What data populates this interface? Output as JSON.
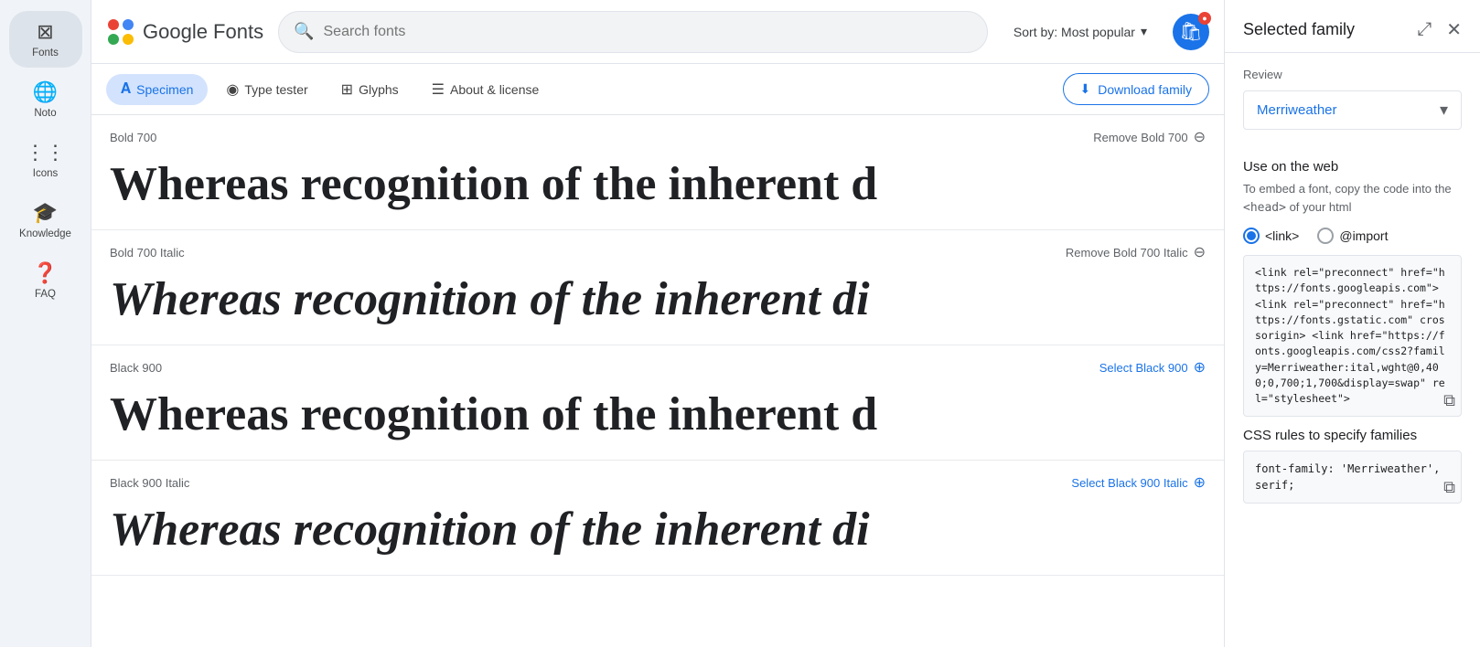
{
  "sidebar": {
    "items": [
      {
        "id": "fonts",
        "label": "Fonts",
        "icon": "🔤"
      },
      {
        "id": "noto",
        "label": "Noto",
        "icon": "🌐"
      },
      {
        "id": "icons",
        "label": "Icons",
        "icon": "🔷"
      },
      {
        "id": "knowledge",
        "label": "Knowledge",
        "icon": "🎓"
      },
      {
        "id": "faq",
        "label": "FAQ",
        "icon": "❓"
      }
    ]
  },
  "topbar": {
    "app_name": "Google Fonts",
    "search_placeholder": "Search fonts",
    "sort_label": "Sort by: Most popular",
    "cart_count": ""
  },
  "sub_nav": {
    "tabs": [
      {
        "id": "specimen",
        "label": "Specimen",
        "icon": "A",
        "active": true
      },
      {
        "id": "type-tester",
        "label": "Type tester",
        "icon": "◉"
      },
      {
        "id": "glyphs",
        "label": "Glyphs",
        "icon": "⊞"
      },
      {
        "id": "about",
        "label": "About & license",
        "icon": "☰"
      }
    ],
    "download_btn": "Download family"
  },
  "font_entries": [
    {
      "id": "bold-700",
      "style_label": "Bold 700",
      "action_label": "Remove Bold 700",
      "action_type": "remove",
      "preview_text": "Whereas recognition of the inherent d",
      "italic": false,
      "weight_class": "bold"
    },
    {
      "id": "bold-700-italic",
      "style_label": "Bold 700 Italic",
      "action_label": "Remove Bold 700 Italic",
      "action_type": "remove",
      "preview_text": "Whereas recognition of the inherent di",
      "italic": true,
      "weight_class": "bold"
    },
    {
      "id": "black-900",
      "style_label": "Black 900",
      "action_label": "Select Black 900",
      "action_type": "select",
      "preview_text": "Whereas recognition of the inherent d",
      "italic": false,
      "weight_class": "black"
    },
    {
      "id": "black-900-italic",
      "style_label": "Black 900 Italic",
      "action_label": "Select Black 900 Italic",
      "action_type": "select",
      "preview_text": "Whereas recognition of the inherent di",
      "italic": true,
      "weight_class": "black"
    }
  ],
  "right_panel": {
    "title": "Selected family",
    "review_label": "Review",
    "family_name": "Merriweather",
    "use_on_web_title": "Use on the web",
    "embed_desc": "To embed a font, copy the code into the <head> of your html",
    "radio_options": [
      {
        "id": "link",
        "label": "<link>",
        "selected": true
      },
      {
        "id": "import",
        "label": "@import",
        "selected": false
      }
    ],
    "link_code": "<link rel=\"preconnect\" href=\"https://fonts.googleapis.com\">\n<link rel=\"preconnect\" href=\"https://fonts.gstatic.com\" crossorigin>\n<link href=\"https://fonts.googleapis.com/css2?family=Merriweather:ital,wght@0,400;0,700;1,700&display=swap\" rel=\"stylesheet\">",
    "css_rules_title": "CSS rules to specify families",
    "css_rules_code": "font-family: 'Merriweather', serif;"
  }
}
